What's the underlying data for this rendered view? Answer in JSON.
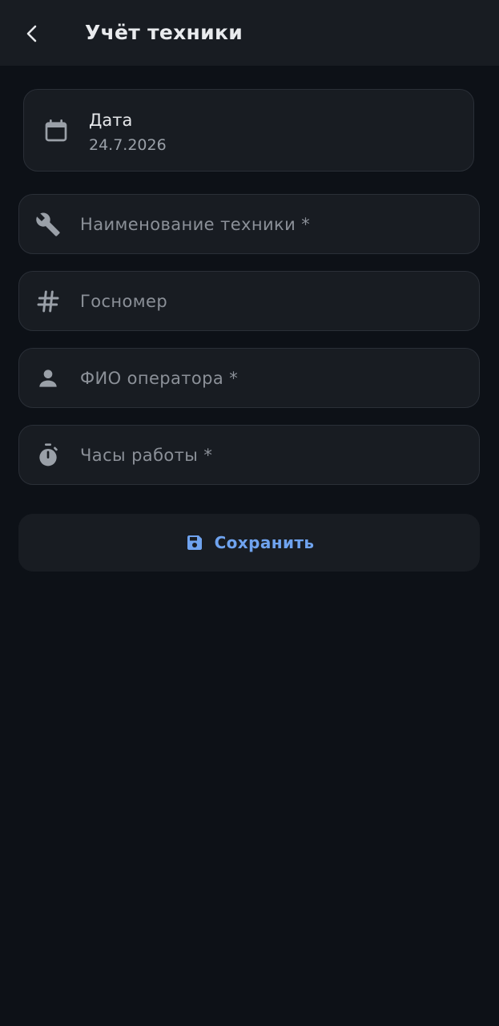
{
  "appbar": {
    "title": "Учёт техники",
    "back_icon": "chevron-left-icon"
  },
  "date": {
    "label": "Дата",
    "value": "24.7.2026",
    "icon": "calendar-icon"
  },
  "fields": [
    {
      "placeholder": "Наименование техники *",
      "value": "",
      "icon": "wrench-icon"
    },
    {
      "placeholder": "Госномер",
      "value": "",
      "icon": "hash-icon"
    },
    {
      "placeholder": "ФИО оператора *",
      "value": "",
      "icon": "person-icon"
    },
    {
      "placeholder": "Часы работы *",
      "value": "",
      "icon": "stopwatch-icon"
    }
  ],
  "save": {
    "label": "Сохранить",
    "icon": "save-icon"
  },
  "colors": {
    "background": "#0d1117",
    "surface": "#181c22",
    "accent": "#6fa3ef",
    "icon": "#9aa0a8"
  }
}
